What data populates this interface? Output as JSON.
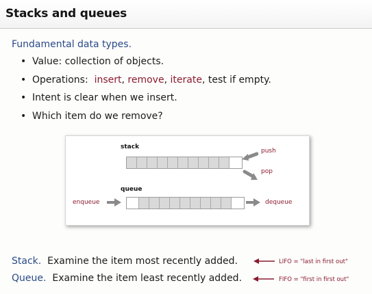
{
  "slide": {
    "title": "Stacks and queues",
    "subtitle": "Fundamental data types.",
    "bullets": {
      "b1": "Value: collection of objects.",
      "b2_prefix": "Operations:",
      "b2_insert": "insert",
      "b2_sep1": ",",
      "b2_remove": "remove",
      "b2_sep2": ",",
      "b2_iterate": "iterate",
      "b2_suffix": ", test if empty.",
      "b3": "Intent is clear when we insert.",
      "b4": "Which item do we remove?"
    },
    "diagram": {
      "stack_label": "stack",
      "push_label": "push",
      "pop_label": "pop",
      "queue_label": "queue",
      "enqueue_label": "enqueue",
      "dequeue_label": "dequeue"
    },
    "footer": {
      "stack_term": "Stack.",
      "stack_desc": "Examine the item most recently added.",
      "stack_note": "LIFO = \"last in first out\"",
      "queue_term": "Queue.",
      "queue_desc": "Examine the item least recently added.",
      "queue_note": "FIFO = \"first in first out\""
    }
  }
}
